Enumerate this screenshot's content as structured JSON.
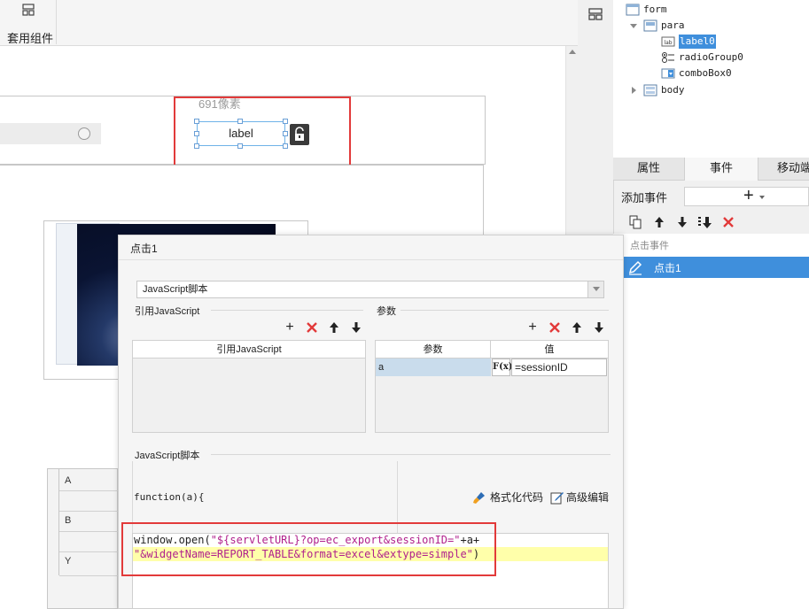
{
  "toolbar": {
    "template_label": "套用组件"
  },
  "canvas": {
    "px_label": "691像素",
    "label_widget_text": "label"
  },
  "grid": {
    "letters": [
      "A",
      "B",
      "Y"
    ]
  },
  "tree": {
    "nodes": [
      {
        "name": "form",
        "icon": "form-icon"
      },
      {
        "name": "para",
        "icon": "para-icon"
      },
      {
        "name": "label0",
        "icon": "label-icon"
      },
      {
        "name": "radioGroup0",
        "icon": "radio-group-icon"
      },
      {
        "name": "comboBox0",
        "icon": "combobox-icon"
      },
      {
        "name": "body",
        "icon": "body-icon"
      }
    ]
  },
  "tabs": [
    "属性",
    "事件",
    "移动端"
  ],
  "events": {
    "add_label": "添加事件",
    "group_label": "点击事件",
    "selected_item": "点击1"
  },
  "dialog": {
    "title": "点击1",
    "type_value": "JavaScript脚本",
    "ref_section": "引用JavaScript",
    "param_section": "参数",
    "ref_column": "引用JavaScript",
    "param_columns": [
      "参数",
      "值"
    ],
    "param_row": {
      "name": "a",
      "fx": "F(x)",
      "value": "=sessionID"
    },
    "script_section": "JavaScript脚本",
    "code_header": "function(a){",
    "format_label": "格式化代码",
    "advanced_label": "高级编辑",
    "code": {
      "line1_prefix": "window.open(",
      "line1_string": "\"${servletURL}?op=ec_export&sessionID=\"",
      "line1_suffix": "+a+",
      "line2_string": "\"&widgetName=REPORT_TABLE&format=excel&extype=simple\"",
      "line2_suffix": ")"
    }
  },
  "colors": {
    "highlight_red": "#e23a3a",
    "selection_blue": "#3f8fdc",
    "code_string": "#b0208c",
    "code_line_highlight": "#ffffaa"
  }
}
